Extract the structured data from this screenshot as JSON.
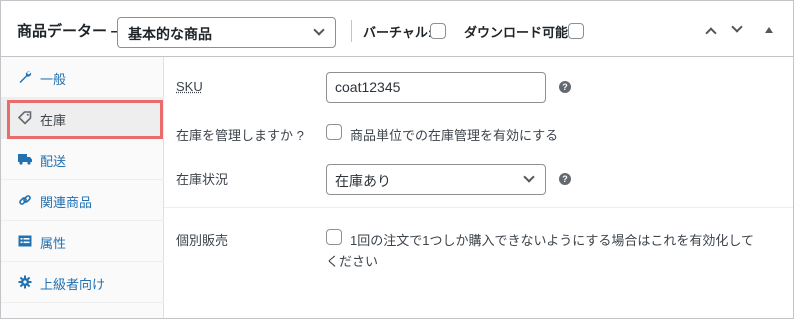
{
  "header": {
    "title": "商品データー —",
    "product_type": "基本的な商品",
    "virtual_label": "バーチャル:",
    "downloadable_label": "ダウンロード可能:"
  },
  "sidebar": {
    "items": [
      {
        "label": "一般",
        "icon": "wrench-icon"
      },
      {
        "label": "在庫",
        "icon": "tag-icon",
        "active": true
      },
      {
        "label": "配送",
        "icon": "truck-icon"
      },
      {
        "label": "関連商品",
        "icon": "link-icon"
      },
      {
        "label": "属性",
        "icon": "list-icon"
      },
      {
        "label": "上級者向け",
        "icon": "gear-icon"
      }
    ]
  },
  "inventory": {
    "sku_label": "SKU",
    "sku_value": "coat12345",
    "manage_stock_label": "在庫を管理しますか ?",
    "manage_stock_text": "商品単位での在庫管理を有効にする",
    "stock_status_label": "在庫状況",
    "stock_status_value": "在庫あり",
    "sold_individually_label": "個別販売",
    "sold_individually_text": "1回の注文で1つしか購入できないようにする場合はこれを有効化してください"
  },
  "colors": {
    "link": "#2271b1",
    "highlight": "#ea6b6b",
    "border": "#c3c4c7"
  }
}
